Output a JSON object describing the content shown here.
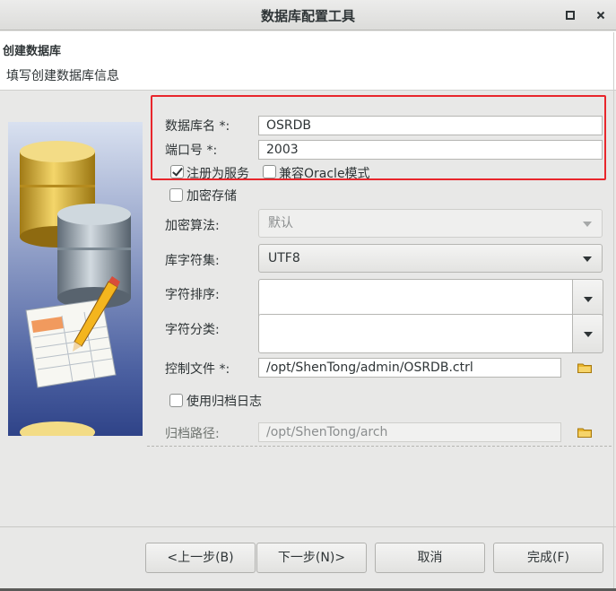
{
  "window": {
    "title": "数据库配置工具",
    "maximize_icon": "maximize-icon",
    "close_icon": "close-icon"
  },
  "header": {
    "title": "创建数据库",
    "subtitle": "填写创建数据库信息"
  },
  "form": {
    "db_name": {
      "label": "数据库名 *:",
      "value": "OSRDB"
    },
    "port": {
      "label": "端口号 *:",
      "value": "2003"
    },
    "register_service": {
      "label": "注册为服务",
      "checked": true
    },
    "oracle_compat": {
      "label": "兼容Oracle模式",
      "checked": false
    },
    "encrypt_storage": {
      "label": "加密存储",
      "checked": false
    },
    "encrypt_algo": {
      "label": "加密算法:",
      "value": "默认",
      "disabled": true
    },
    "charset": {
      "label": "库字符集:",
      "value": "UTF8"
    },
    "collation": {
      "label": "字符排序:",
      "value": ""
    },
    "char_class": {
      "label": "字符分类:",
      "value": ""
    },
    "control_file": {
      "label": "控制文件 *:",
      "value": "/opt/ShenTong/admin/OSRDB.ctrl",
      "icon": "folder-icon"
    },
    "use_archive_log": {
      "label": "使用归档日志",
      "checked": false
    },
    "archive_path": {
      "label": "归档路径:",
      "value": "/opt/ShenTong/arch",
      "disabled": true,
      "icon": "folder-icon"
    }
  },
  "buttons": {
    "prev": "<上一步(B)",
    "next": "下一步(N)>",
    "cancel": "取消",
    "finish": "完成(F)"
  },
  "colors": {
    "highlight_box": "#e8262c",
    "folder": "#e9b52c"
  }
}
